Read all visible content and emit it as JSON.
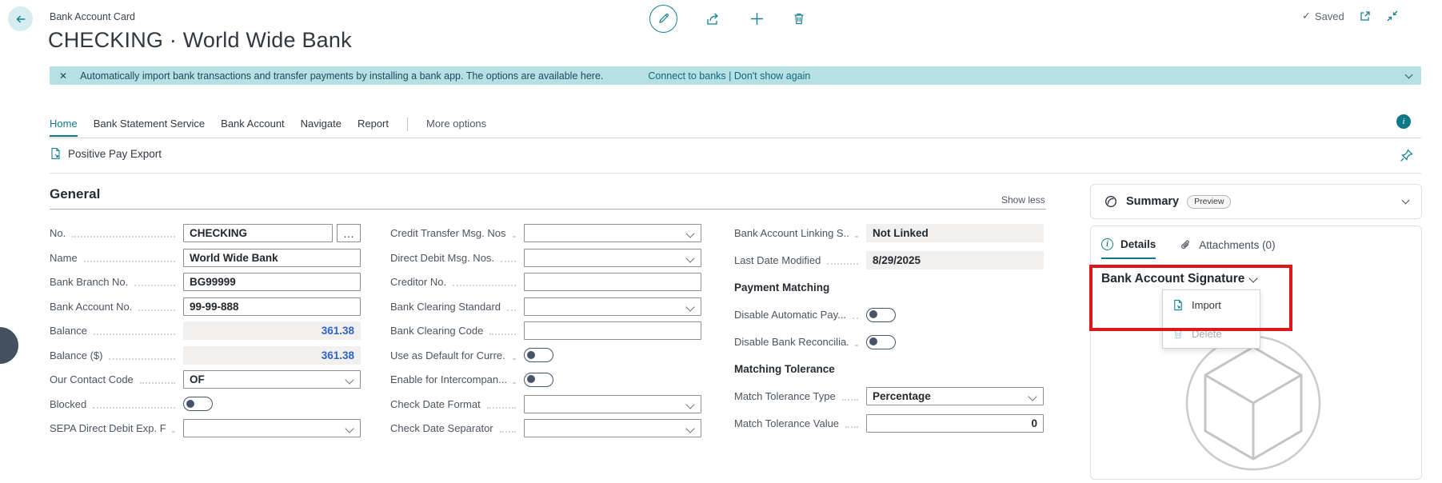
{
  "header": {
    "caption": "Bank Account Card",
    "title": "CHECKING · World Wide Bank",
    "saved": "Saved"
  },
  "banner": {
    "message": "Automatically import bank transactions and transfer payments by installing a bank app. The options are available here.",
    "links": "Connect to banks | Don't show again"
  },
  "nav": {
    "tabs": [
      "Home",
      "Bank Statement Service",
      "Bank Account",
      "Navigate",
      "Report"
    ],
    "more_options": "More options"
  },
  "action_bar": {
    "positive_pay_export": "Positive Pay Export"
  },
  "general": {
    "heading": "General",
    "show_less": "Show less",
    "col1": [
      {
        "label": "No.",
        "value": "CHECKING"
      },
      {
        "label": "Name",
        "value": "World Wide Bank"
      },
      {
        "label": "Bank Branch No.",
        "value": "BG99999"
      },
      {
        "label": "Bank Account No.",
        "value": "99-99-888"
      },
      {
        "label": "Balance",
        "value": "361.38"
      },
      {
        "label": "Balance ($)",
        "value": "361.38"
      },
      {
        "label": "Our Contact Code",
        "value": "OF"
      },
      {
        "label": "Blocked",
        "value": "off"
      },
      {
        "label": "SEPA Direct Debit Exp. F...",
        "value": ""
      }
    ],
    "col2": [
      {
        "label": "Credit Transfer Msg. Nos.",
        "value": ""
      },
      {
        "label": "Direct Debit Msg. Nos.",
        "value": ""
      },
      {
        "label": "Creditor No.",
        "value": ""
      },
      {
        "label": "Bank Clearing Standard",
        "value": ""
      },
      {
        "label": "Bank Clearing Code",
        "value": ""
      },
      {
        "label": "Use as Default for Curre...",
        "value": "off"
      },
      {
        "label": "Enable for Intercompan...",
        "value": "off"
      },
      {
        "label": "Check Date Format",
        "value": ""
      },
      {
        "label": "Check Date Separator",
        "value": ""
      }
    ],
    "col3": [
      {
        "label": "Bank Account Linking S...",
        "value": "Not Linked"
      },
      {
        "label": "Last Date Modified",
        "value": "8/29/2025"
      },
      {
        "label": "Payment Matching",
        "value": ""
      },
      {
        "label": "Disable Automatic Pay...",
        "value": "off"
      },
      {
        "label": "Disable Bank Reconcilia...",
        "value": "off"
      },
      {
        "label": "Matching Tolerance",
        "value": ""
      },
      {
        "label": "Match Tolerance Type",
        "value": "Percentage"
      },
      {
        "label": "Match Tolerance Value",
        "value": "0"
      }
    ]
  },
  "factbox": {
    "summary": {
      "title": "Summary",
      "badge": "Preview"
    },
    "tabs": {
      "details": "Details",
      "attachments": "Attachments (0)"
    },
    "signature_heading": "Bank Account Signature",
    "menu": {
      "import": "Import",
      "delete": "Delete"
    }
  },
  "icons": {
    "close": "✕",
    "check": "✓",
    "ellipsis": "…",
    "info": "i"
  },
  "colors": {
    "accent": "#0e7888",
    "banner_bg": "#b6e0e4",
    "annotation_red": "#e0161f",
    "value_blue": "#2f63c0"
  }
}
